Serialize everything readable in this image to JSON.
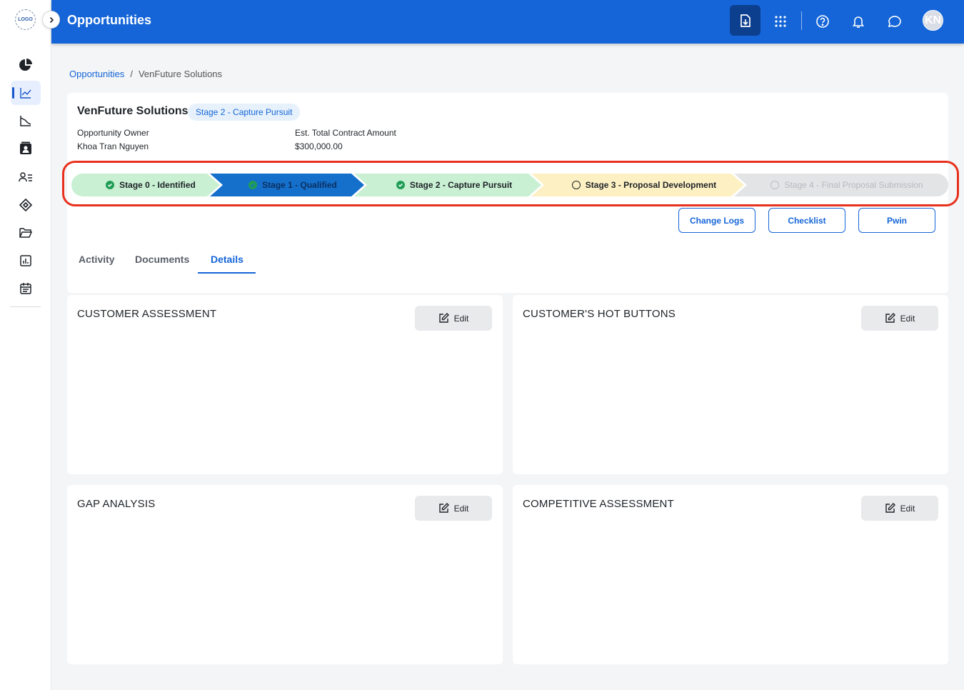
{
  "app": {
    "logo_text": "LOGO",
    "title": "Opportunities"
  },
  "topbar": {
    "icons": [
      "export-icon",
      "apps-grid-icon",
      "help-icon",
      "bell-icon",
      "chat-icon"
    ],
    "avatar_initials": "KN"
  },
  "sidebar": {
    "items": [
      {
        "icon": "pie-chart-icon"
      },
      {
        "icon": "trend-chart-icon",
        "active": true
      },
      {
        "icon": "funnel-chart-icon"
      },
      {
        "icon": "contact-card-icon"
      },
      {
        "icon": "user-list-icon"
      },
      {
        "icon": "tag-icon"
      },
      {
        "icon": "folder-open-icon"
      },
      {
        "icon": "report-icon"
      },
      {
        "icon": "calendar-icon"
      }
    ]
  },
  "breadcrumb": {
    "parent": "Opportunities",
    "separator": "/",
    "current": "VenFuture Solutions"
  },
  "opportunity": {
    "name": "VenFuture Solutions",
    "stage_badge": "Stage 2 - Capture Pursuit",
    "owner_label": "Opportunity Owner",
    "owner_value": "Khoa Tran Nguyen",
    "amount_label": "Est. Total Contract Amount",
    "amount_value": "$300,000.00"
  },
  "stages": [
    {
      "label": "Stage 0 - Identified",
      "status": "done",
      "bg": "#c9f0d3",
      "fg": "#1f2328"
    },
    {
      "label": "Stage 1 - Qualified",
      "status": "done",
      "bg": "#1570cc",
      "fg": "#0b2f5e"
    },
    {
      "label": "Stage 2 - Capture Pursuit",
      "status": "done",
      "bg": "#c9f0d3",
      "fg": "#1f2328"
    },
    {
      "label": "Stage 3 - Proposal Development",
      "status": "open",
      "bg": "#fdf0c3",
      "fg": "#1f2328"
    },
    {
      "label": "Stage 4 - Final Proposal Submission",
      "status": "off",
      "bg": "#e3e4e6",
      "fg": "#b5b9bf"
    }
  ],
  "actions": {
    "change_logs": "Change Logs",
    "checklist": "Checklist",
    "pwin": "Pwin"
  },
  "tabs": {
    "activity": "Activity",
    "documents": "Documents",
    "details": "Details",
    "active": "Details"
  },
  "cards": {
    "customer_assessment": "CUSTOMER ASSESSMENT",
    "hot_buttons": "CUSTOMER'S HOT BUTTONS",
    "gap_analysis": "GAP ANALYSIS",
    "competitive_assessment": "COMPETITIVE ASSESSMENT",
    "edit_label": "Edit"
  },
  "colors": {
    "primary": "#1565d8",
    "highlight_outline": "#e8311d",
    "done": "#1f9d55"
  }
}
